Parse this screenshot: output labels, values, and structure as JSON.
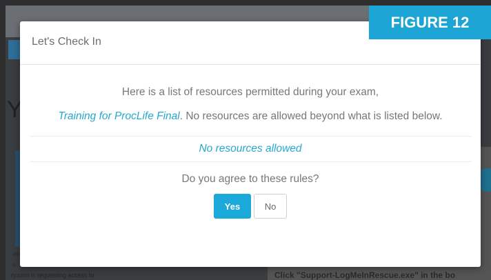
{
  "figure_badge": "FIGURE 12",
  "modal": {
    "title": "Let's Check In",
    "intro_prefix": "Here is a list of resources permitted during your exam,",
    "exam_name": "Training for ProcLife Final",
    "intro_suffix": ". No resources are allowed beyond what is listed below.",
    "resources_message": "No resources allowed",
    "question": "Do you agree to these rules?",
    "yes_label": "Yes",
    "no_label": "No"
  },
  "background": {
    "letter": "Y",
    "bottom_left_text": "ry.com is requesting access to",
    "bottom_right_text": "Click \"Support-LogMeInRescue.exe\" in the bo",
    "side_text_1": "asi",
    "side_text_2": "a"
  },
  "colors": {
    "accent": "#1aa9d8",
    "link": "#26a7cf",
    "badge": "#1ba4d4"
  }
}
